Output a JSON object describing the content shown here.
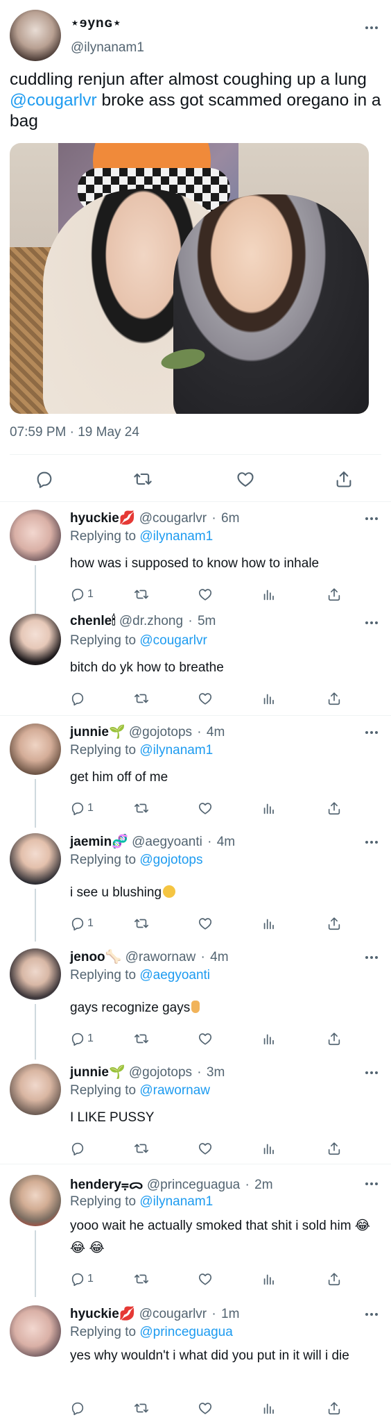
{
  "main_tweet": {
    "display_name": "⋆ɘynɢ⋆",
    "handle": "@ilynanam1",
    "text_before_mention": "cuddling renjun after almost coughing up a lung ",
    "mention": "@cougarlvr",
    "text_after_mention": " broke ass got scammed oregano in a bag",
    "timestamp": "07:59 PM · 19 May 24"
  },
  "icons": {
    "reply": "reply-icon",
    "retweet": "retweet-icon",
    "like": "heart-icon",
    "views": "views-icon",
    "share": "share-icon",
    "more": "more-icon"
  },
  "colors": {
    "link": "#1d9bf0",
    "muted": "#536471",
    "divider": "#eff3f4",
    "thread_line": "#cfd9de"
  },
  "replies": [
    {
      "name": "hyuckie💋",
      "handle": "@cougarlvr",
      "time": "6m",
      "replying_label": "Replying to",
      "replying_to": "@ilynanam1",
      "text": "how was i supposed to know how to inhale",
      "reply_count": "1"
    },
    {
      "name": "chenle🕯",
      "handle": "@dr.zhong",
      "time": "5m",
      "replying_label": "Replying to",
      "replying_to": "@cougarlvr",
      "text": "bitch do yk how to breathe",
      "reply_count": ""
    },
    {
      "name": "junnie🌱",
      "handle": "@gojotops",
      "time": "4m",
      "replying_label": "Replying to",
      "replying_to": "@ilynanam1",
      "text": "get him off of me",
      "reply_count": "1"
    },
    {
      "name": "jaemin🧬",
      "handle": "@aegyoanti",
      "time": "4m",
      "replying_label": "Replying to",
      "replying_to": "@gojotops",
      "text": "i see u blushing",
      "reply_count": "1"
    },
    {
      "name": "jenoo🦴",
      "handle": "@rawornaw",
      "time": "4m",
      "replying_label": "Replying to",
      "replying_to": "@aegyoanti",
      "text": "gays recognize gays",
      "reply_count": "1"
    },
    {
      "name": "junnie🌱",
      "handle": "@gojotops",
      "time": "3m",
      "replying_label": "Replying to",
      "replying_to": "@rawornaw",
      "text": "I LIKE PUSSY",
      "reply_count": ""
    },
    {
      "name": "hendery⩦ᯅ",
      "handle": "@princeguagua",
      "time": "2m",
      "replying_label": "Replying to",
      "replying_to": "@ilynanam1",
      "text": "yooo wait he actually smoked that shit i sold him 😂 😂 😂",
      "reply_count": "1"
    },
    {
      "name": "hyuckie💋",
      "handle": "@cougarlvr",
      "time": "1m",
      "replying_label": "Replying to",
      "replying_to": "@princeguagua",
      "text": "yes why wouldn't i what did you put in it will i die",
      "reply_count": ""
    }
  ]
}
